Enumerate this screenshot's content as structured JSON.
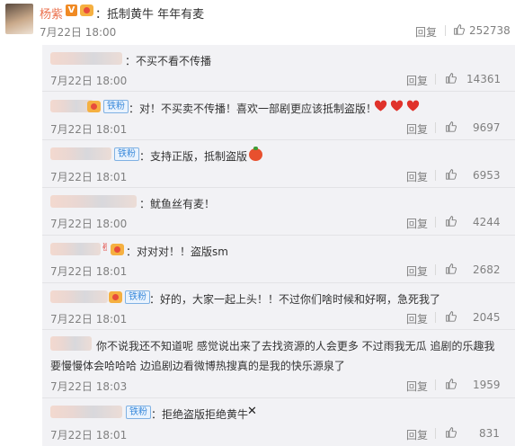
{
  "top": {
    "author": "杨紫",
    "verified_badge": "V",
    "text": "：抵制黄牛 年年有麦",
    "date": "7月22日 18:00",
    "reply_label": "回复",
    "likes": "252738"
  },
  "fan_badge": "铁粉",
  "replies": [
    {
      "text": "：不买不看不传播",
      "date": "7月22日 18:00",
      "reply_label": "回复",
      "likes": "14361",
      "fan": false
    },
    {
      "text": "：对！不买卖不传播！喜欢一部剧更应该抵制盗版！",
      "date": "7月22日 18:01",
      "reply_label": "回复",
      "likes": "9697",
      "fan": true,
      "emoji": "red-heart-icon x3"
    },
    {
      "text": "：支持正版，抵制盗版",
      "date": "7月22日 18:01",
      "reply_label": "回复",
      "likes": "6953",
      "fan": true,
      "emoji": "tomato-icon"
    },
    {
      "text": "：鱿鱼丝有麦！",
      "date": "7月22日 18:00",
      "reply_label": "回复",
      "likes": "4244",
      "fan": false
    },
    {
      "text": "：对对对！！盗版sm",
      "date": "7月22日 18:01",
      "reply_label": "回复",
      "likes": "2682",
      "fan": false
    },
    {
      "text": "：好的，大家一起上头！！不过你们啥时候和好啊，急死我了",
      "date": "7月22日 18:01",
      "reply_label": "回复",
      "likes": "2045",
      "fan": true
    },
    {
      "text_line1": "你不说我还不知道呢 感觉说出来了去找资源的人会更多 不过雨我无瓜 追剧的乐趣我",
      "text_line2": "要慢慢体会哈哈哈 边追剧边看微博热搜真的是我的快乐源泉了",
      "date": "7月22日 18:03",
      "reply_label": "回复",
      "likes": "1959",
      "fan": false
    },
    {
      "text": "：拒绝盗版拒绝黄牛",
      "date": "7月22日 18:01",
      "reply_label": "回复",
      "likes": "831",
      "fan": true,
      "emoji": "cross-mark-icon"
    }
  ],
  "colors": {
    "name": "#eb7350",
    "fan_badge": "#3a8adb",
    "panel": "#f2f2f5",
    "heart": "#e0322b"
  }
}
